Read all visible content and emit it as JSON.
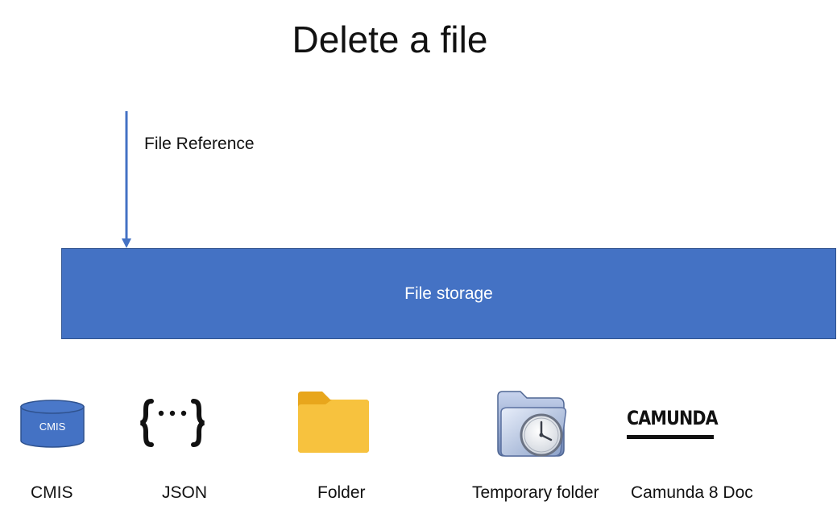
{
  "title": "Delete a file",
  "input": {
    "label": "File Reference"
  },
  "storage": {
    "label": "File storage"
  },
  "backends": [
    {
      "label": "CMIS",
      "icon": "database-icon",
      "icon_text": "CMIS"
    },
    {
      "label": "JSON",
      "icon": "json-braces-icon"
    },
    {
      "label": "Folder",
      "icon": "folder-icon"
    },
    {
      "label": "Temporary folder",
      "icon": "temporary-folder-clock-icon"
    },
    {
      "label": "Camunda 8 Doc",
      "icon": "camunda-logo",
      "icon_text": "CAMUNDA"
    }
  ],
  "colors": {
    "storage_fill": "#4472c4",
    "arrow": "#4472c4",
    "folder_yellow": "#f4b623",
    "text": "#111111"
  }
}
